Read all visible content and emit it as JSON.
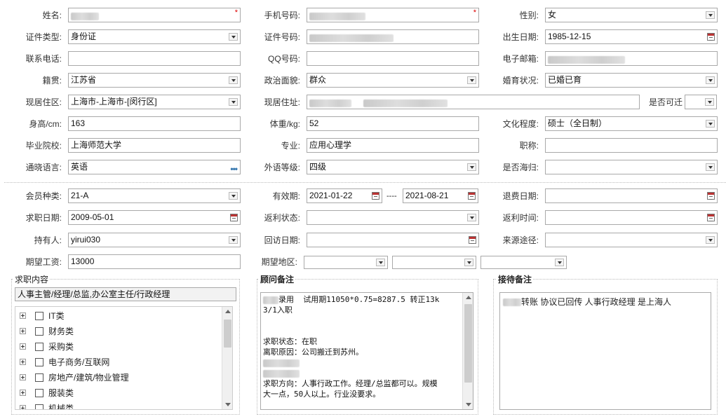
{
  "rows": [
    [
      {
        "label": "姓名:",
        "value": "",
        "blur": 40,
        "kind": "text",
        "required": true,
        "w": 246
      },
      {
        "label": "手机号码:",
        "value": "",
        "blur": 80,
        "kind": "text",
        "required": true,
        "w": 246
      },
      {
        "label": "性别:",
        "value": "女",
        "kind": "select",
        "w": 246
      }
    ],
    [
      {
        "label": "证件类型:",
        "value": "身份证",
        "kind": "select",
        "w": 246
      },
      {
        "label": "证件号码:",
        "value": "",
        "blur": 120,
        "kind": "text",
        "w": 246
      },
      {
        "label": "出生日期:",
        "value": "1985-12-15",
        "kind": "date",
        "w": 246
      }
    ],
    [
      {
        "label": "联系电话:",
        "value": "",
        "kind": "text",
        "w": 246
      },
      {
        "label": "QQ号码:",
        "value": "",
        "kind": "text",
        "w": 246
      },
      {
        "label": "电子邮箱:",
        "value": "",
        "blur": 110,
        "kind": "text",
        "w": 246
      }
    ],
    [
      {
        "label": "籍贯:",
        "value": "江苏省",
        "kind": "select",
        "w": 246
      },
      {
        "label": "政治面貌:",
        "value": "群众",
        "kind": "select",
        "w": 246
      },
      {
        "label": "婚育状况:",
        "value": "已婚已育",
        "kind": "select",
        "w": 246
      }
    ]
  ],
  "row5": {
    "residence_label": "现居住区:",
    "residence": "上海市-上海市-[闵行区]",
    "address_label": "现居住址:",
    "address": "",
    "relocate_label": "是否可迁",
    "relocate": ""
  },
  "rows2": [
    [
      {
        "label": "身高/cm:",
        "value": "163",
        "kind": "text",
        "w": 246
      },
      {
        "label": "体重/kg:",
        "value": "52",
        "kind": "text",
        "w": 246
      },
      {
        "label": "文化程度:",
        "value": "硕士（全日制）",
        "kind": "select",
        "w": 246
      }
    ],
    [
      {
        "label": "毕业院校:",
        "value": "上海师范大学",
        "kind": "text",
        "w": 246
      },
      {
        "label": "专业:",
        "value": "应用心理学",
        "kind": "text",
        "w": 246
      },
      {
        "label": "职称:",
        "value": "",
        "kind": "text",
        "w": 246
      }
    ],
    [
      {
        "label": "通晓语言:",
        "value": "英语",
        "kind": "picker",
        "w": 246
      },
      {
        "label": "外语等级:",
        "value": "四级",
        "kind": "select",
        "w": 246
      },
      {
        "label": "是否海归:",
        "value": "",
        "kind": "select",
        "w": 246
      }
    ]
  ],
  "member": {
    "type_label": "会员种类:",
    "type": "21-A",
    "valid_label": "有效期:",
    "valid_from": "2021-01-22",
    "valid_sep": "----",
    "valid_to": "2021-08-21",
    "refund_label": "退费日期:",
    "refund": ""
  },
  "rows3": [
    [
      {
        "label": "求职日期:",
        "value": "2009-05-01",
        "kind": "date",
        "w": 246
      },
      {
        "label": "返利状态:",
        "value": "",
        "kind": "select",
        "w": 246
      },
      {
        "label": "返利时间:",
        "value": "",
        "kind": "date",
        "w": 246
      }
    ],
    [
      {
        "label": "持有人:",
        "value": "yirui030",
        "kind": "select",
        "w": 246
      },
      {
        "label": "回访日期:",
        "value": "",
        "kind": "date",
        "w": 246
      },
      {
        "label": "来源途径:",
        "value": "",
        "kind": "select",
        "w": 246
      }
    ]
  ],
  "salary": {
    "label": "期望工资:",
    "value": "13000",
    "area_label": "期望地区:"
  },
  "job_panel": {
    "title": "求职内容",
    "selected": "人事主管/经理/总监,办公室主任/行政经理",
    "tree": [
      "IT类",
      "财务类",
      "采购类",
      "电子商务/互联网",
      "房地产/建筑/物业管理",
      "服装类",
      "机械类"
    ]
  },
  "advisor_panel": {
    "title": "顾问备注",
    "lines": [
      "录用  试用期11050*0.75=8287.5 转正13k",
      "3/1入职",
      "",
      "",
      "求职状态：在职",
      "离职原因：公司搬迁到苏州。",
      "",
      "",
      "求职方向：人事行政工作。经理/总监都可以。规模",
      "大一点，50人以上。行业没要求。"
    ]
  },
  "reception_panel": {
    "title": "接待备注",
    "text": "转账 协议已回传 人事行政经理  是上海人"
  }
}
